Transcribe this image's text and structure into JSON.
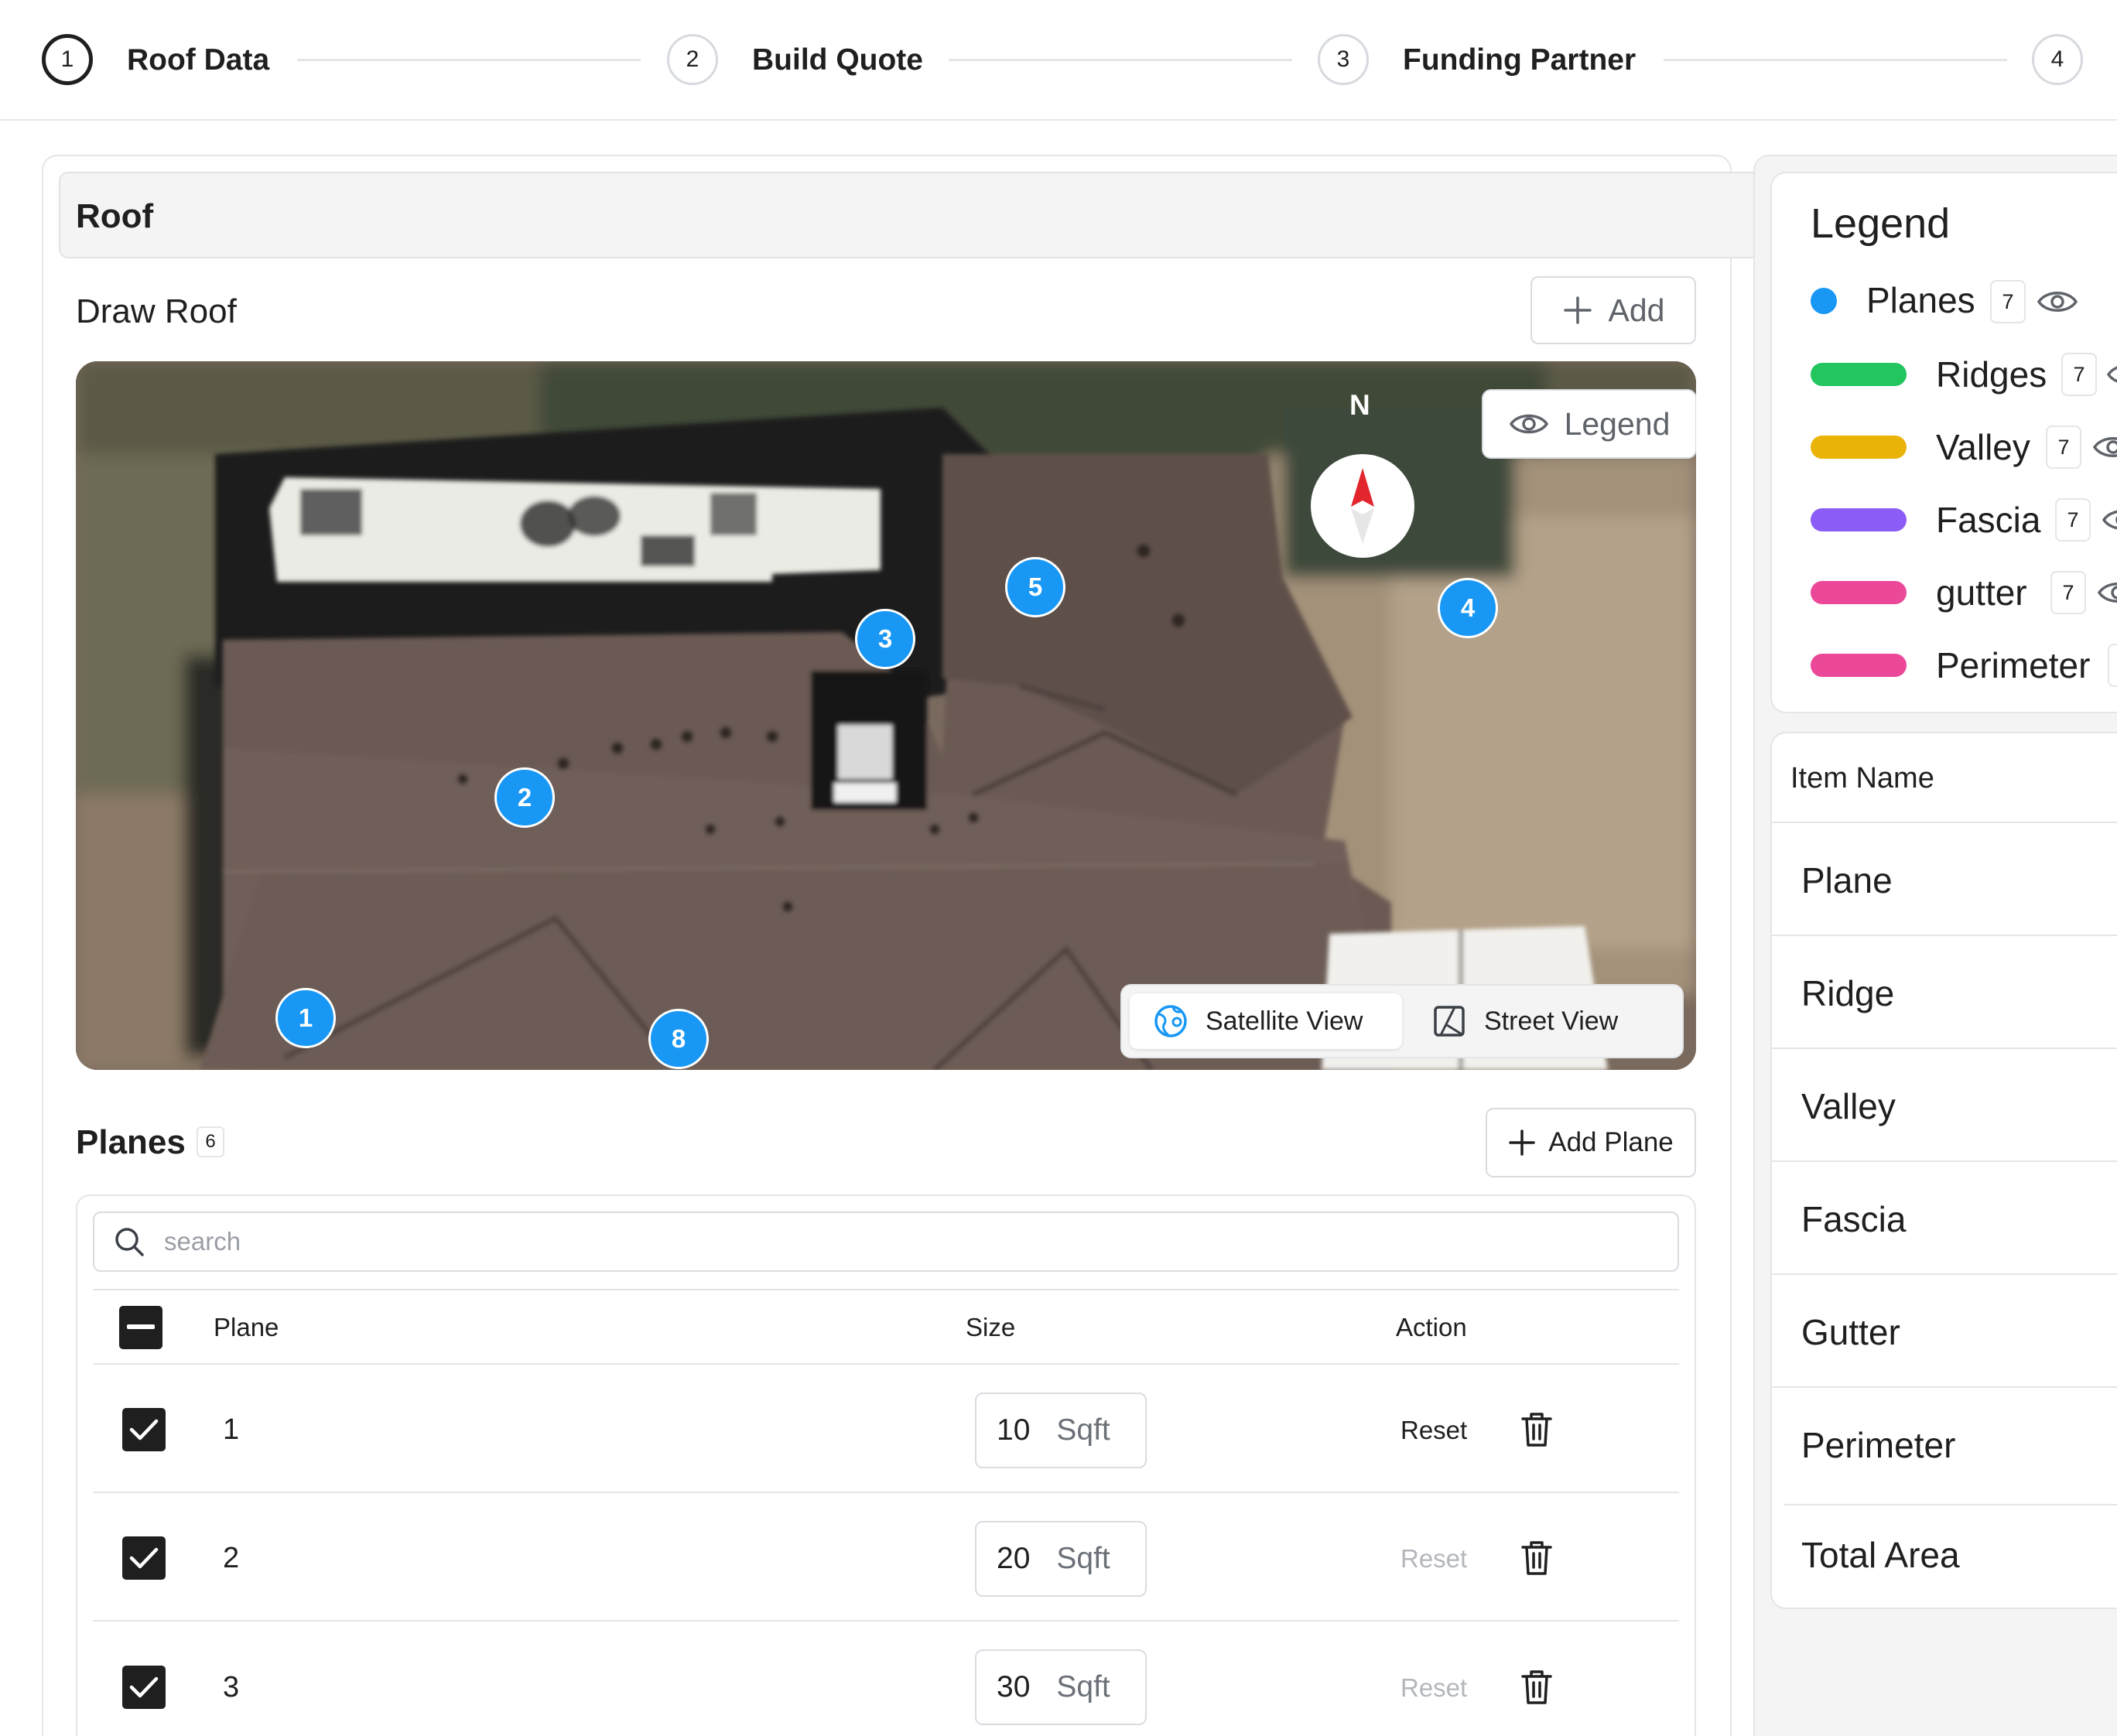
{
  "stepper": {
    "steps": [
      {
        "number": "1",
        "label": "Roof Data"
      },
      {
        "number": "2",
        "label": "Build Quote"
      },
      {
        "number": "3",
        "label": "Funding Partner"
      },
      {
        "number": "4",
        "label": ""
      }
    ]
  },
  "roof": {
    "title": "Roof",
    "draw_title": "Draw Roof",
    "add_label": "Add"
  },
  "map": {
    "compass_label": "N",
    "legend_button": "Legend",
    "pins": [
      "1",
      "2",
      "3",
      "4",
      "5",
      "8"
    ],
    "views": {
      "satellite": "Satellite View",
      "street": "Street View",
      "selected": "satellite"
    }
  },
  "planes": {
    "title": "Planes",
    "count": "6",
    "add_label": "Add Plane",
    "search_placeholder": "search",
    "columns": {
      "plane": "Plane",
      "size": "Size",
      "action": "Action"
    },
    "rows": [
      {
        "name": "1",
        "size": "10",
        "unit": "Sqft",
        "reset": "Reset",
        "reset_enabled": true,
        "checked": true
      },
      {
        "name": "2",
        "size": "20",
        "unit": "Sqft",
        "reset": "Reset",
        "reset_enabled": false,
        "checked": true
      },
      {
        "name": "3",
        "size": "30",
        "unit": "Sqft",
        "reset": "Reset",
        "reset_enabled": false,
        "checked": true
      }
    ]
  },
  "legend": {
    "title": "Legend",
    "items": [
      {
        "label": "Planes",
        "count": "7",
        "color": "#1897f5",
        "shape": "dot"
      },
      {
        "label": "Ridges",
        "count": "7",
        "color": "#22c55e",
        "shape": "bar"
      },
      {
        "label": "Valley",
        "count": "7",
        "color": "#eab308",
        "shape": "bar"
      },
      {
        "label": "Fascia",
        "count": "7",
        "color": "#8b5cf6",
        "shape": "bar"
      },
      {
        "label": "gutter",
        "count": "7",
        "color": "#ec4899",
        "shape": "bar"
      },
      {
        "label": "Perimeter",
        "count": "",
        "color": "#ec4899",
        "shape": "bar"
      }
    ]
  },
  "items_table": {
    "header": "Item Name",
    "rows": [
      "Plane",
      "Ridge",
      "Valley",
      "Fascia",
      "Gutter",
      "Perimeter",
      "Total Area"
    ]
  },
  "icons": [
    "plus-icon",
    "eye-icon",
    "compass-arrow-icon",
    "globe-icon",
    "map-icon",
    "search-icon",
    "check-icon",
    "minus-icon",
    "trash-icon"
  ]
}
